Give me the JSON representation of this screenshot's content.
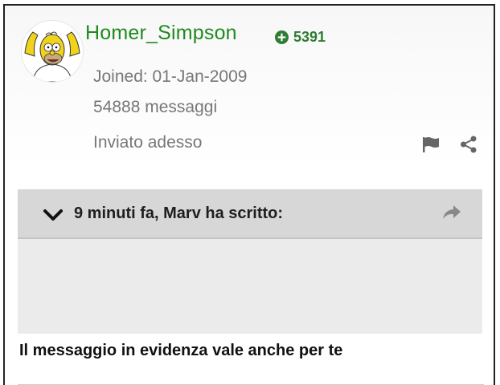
{
  "post": {
    "username": "Homer_Simpson",
    "reputation": "5391",
    "joined": "Joined: 01-Jan-2009",
    "post_count": "54888 messaggi",
    "posted": "Inviato adesso"
  },
  "quote": {
    "header": "9 minuti fa, Marv ha scritto:"
  },
  "message": {
    "text": "Il messaggio in evidenza vale anche per te"
  },
  "icons": {
    "reputation": "plus-circle-icon",
    "report": "flag-icon",
    "share": "share-icon",
    "collapse": "chevron-down-icon",
    "go_to_quote": "share-arrow-icon"
  },
  "colors": {
    "username": "#1f8a1f",
    "reputation": "#2e7d32",
    "meta_text": "#777777",
    "quote_header_bg": "#d7d7d7",
    "quote_body_bg": "#ebebeb"
  }
}
